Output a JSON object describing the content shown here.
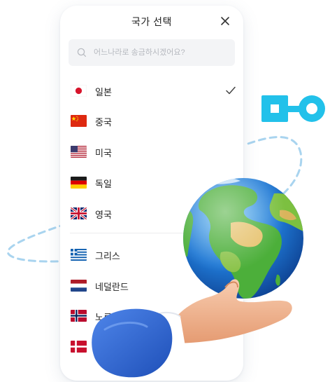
{
  "header": {
    "title": "국가 선택",
    "close_icon": "close-icon"
  },
  "search": {
    "placeholder": "어느나라로 송금하시겠어요?",
    "value": "",
    "icon": "search-icon"
  },
  "countries_top": [
    {
      "name": "일본",
      "flag": "japan-flag-icon",
      "selected": true
    },
    {
      "name": "중국",
      "flag": "china-flag-icon",
      "selected": false
    },
    {
      "name": "미국",
      "flag": "usa-flag-icon",
      "selected": false
    },
    {
      "name": "독일",
      "flag": "germany-flag-icon",
      "selected": false
    },
    {
      "name": "영국",
      "flag": "uk-flag-icon",
      "selected": false
    }
  ],
  "countries_more": [
    {
      "name": "그리스",
      "flag": "greece-flag-icon",
      "selected": false
    },
    {
      "name": "네덜란드",
      "flag": "netherlands-flag-icon",
      "selected": false
    },
    {
      "name": "노르웨이",
      "flag": "norway-flag-icon",
      "selected": false
    },
    {
      "name": "",
      "flag": "denmark-flag-icon",
      "selected": false
    }
  ],
  "colors": {
    "accent_cyan": "#22c1ea",
    "orbit_dash": "#a9d4ef",
    "sleeve_blue": "#2f69d8",
    "skin": "#f2b690",
    "ocean": "#1f78d4",
    "land": "#4caf3a"
  },
  "illustration": {
    "globe": "globe-icon",
    "hand": "hand-icon",
    "link": "link-icon"
  }
}
